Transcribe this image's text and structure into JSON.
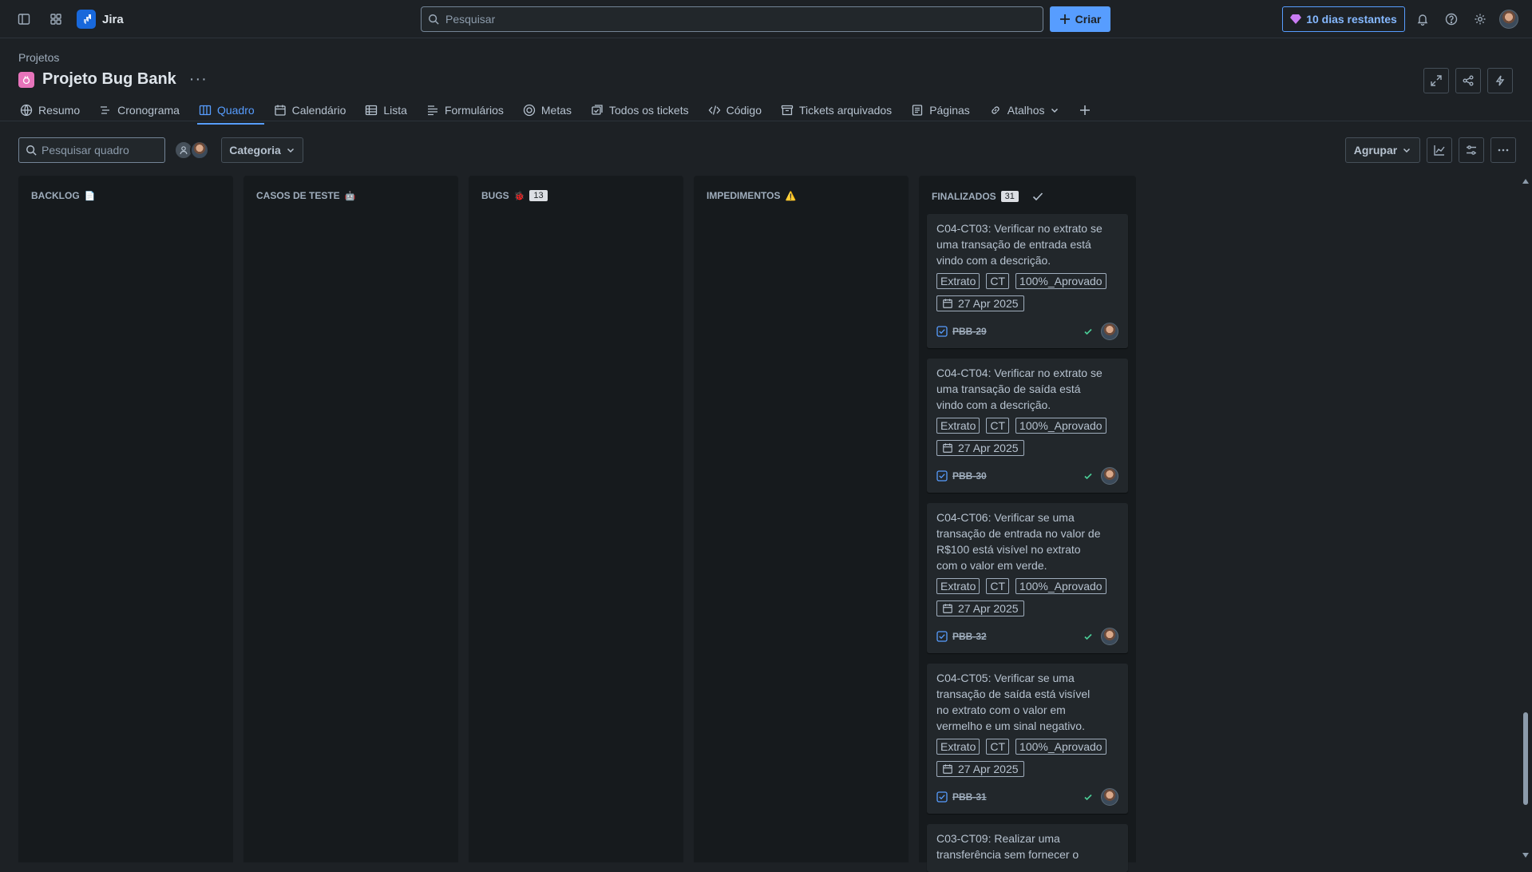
{
  "topbar": {
    "app_name": "Jira",
    "search_placeholder": "Pesquisar",
    "create_label": "Criar",
    "trial_label": "10 dias restantes"
  },
  "project": {
    "breadcrumb": "Projetos",
    "name": "Projeto Bug Bank",
    "more": "···"
  },
  "tabs": [
    {
      "label": "Resumo",
      "icon": "globe-icon"
    },
    {
      "label": "Cronograma",
      "icon": "timeline-icon"
    },
    {
      "label": "Quadro",
      "icon": "board-icon",
      "active": true
    },
    {
      "label": "Calendário",
      "icon": "calendar-icon"
    },
    {
      "label": "Lista",
      "icon": "list-icon"
    },
    {
      "label": "Formulários",
      "icon": "form-icon"
    },
    {
      "label": "Metas",
      "icon": "target-icon"
    },
    {
      "label": "Todos os tickets",
      "icon": "tickets-icon"
    },
    {
      "label": "Código",
      "icon": "code-icon"
    },
    {
      "label": "Tickets arquivados",
      "icon": "archive-icon"
    },
    {
      "label": "Páginas",
      "icon": "pages-icon"
    },
    {
      "label": "Atalhos",
      "icon": "link-icon"
    }
  ],
  "board": {
    "search_placeholder": "Pesquisar quadro",
    "category_label": "Categoria",
    "group_label": "Agrupar"
  },
  "columns": [
    {
      "title": "BACKLOG",
      "emoji": "📄",
      "count": ""
    },
    {
      "title": "CASOS DE TESTE",
      "emoji": "🤖",
      "count": ""
    },
    {
      "title": "BUGS",
      "emoji": "🐞",
      "count": "13"
    },
    {
      "title": "IMPEDIMENTOS",
      "emoji": "⚠️",
      "count": ""
    },
    {
      "title": "FINALIZADOS",
      "emoji": "",
      "count": "31"
    }
  ],
  "cards": [
    {
      "title": "C04-CT03: Verificar no extrato se uma transação de entrada está vindo com a descrição.",
      "labels": [
        "Extrato",
        "CT",
        "100%_Aprovado"
      ],
      "date": "27 Apr 2025",
      "key": "PBB-29"
    },
    {
      "title": "C04-CT04: Verificar no extrato se uma transação de saída está vindo com a descrição.",
      "labels": [
        "Extrato",
        "CT",
        "100%_Aprovado"
      ],
      "date": "27 Apr 2025",
      "key": "PBB-30"
    },
    {
      "title": "C04-CT06: Verificar se uma transação de entrada no valor de R$100 está visível no extrato com o valor em verde.",
      "labels": [
        "Extrato",
        "CT",
        "100%_Aprovado"
      ],
      "date": "27 Apr 2025",
      "key": "PBB-32"
    },
    {
      "title": "C04-CT05: Verificar se uma transação de saída está visível no extrato com o valor em vermelho e um sinal negativo.",
      "labels": [
        "Extrato",
        "CT",
        "100%_Aprovado"
      ],
      "date": "27 Apr 2025",
      "key": "PBB-31"
    },
    {
      "title": "C03-CT09: Realizar uma transferência sem fornecer o",
      "labels": [],
      "date": "",
      "key": ""
    }
  ],
  "colors": {
    "accent": "#579dff",
    "background": "#1d2125",
    "column": "#161a1d",
    "card": "#22272b",
    "done_check": "#4bce97"
  }
}
